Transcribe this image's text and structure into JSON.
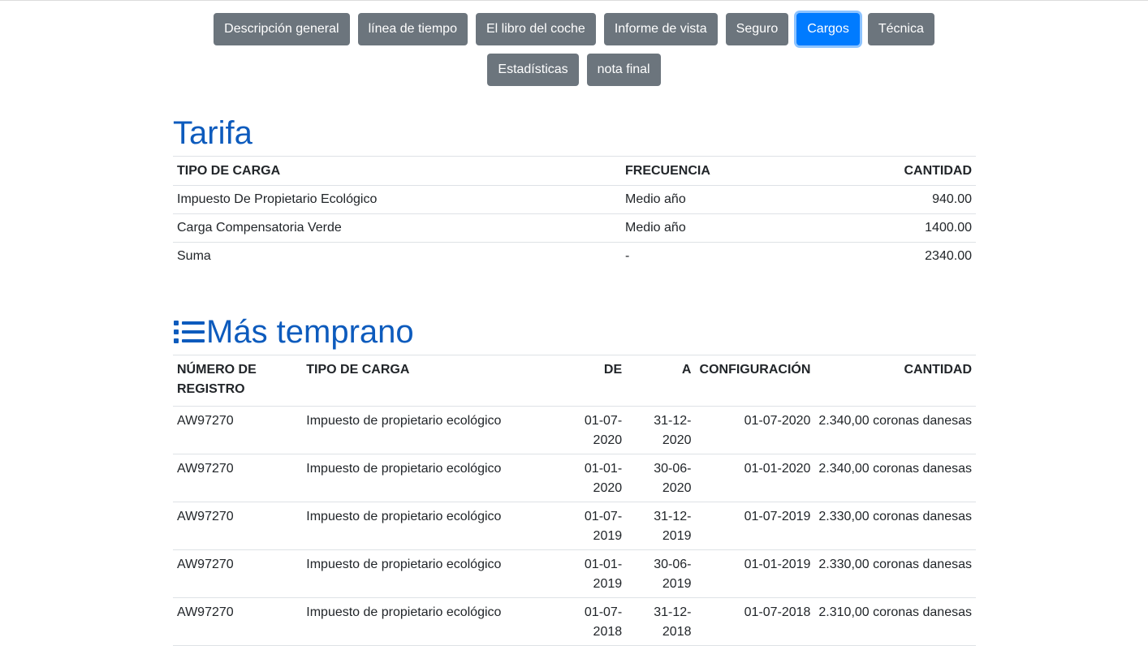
{
  "nav": {
    "row1": [
      {
        "label": "Descripción general",
        "active": false
      },
      {
        "label": "línea de tiempo",
        "active": false
      },
      {
        "label": "El libro del coche",
        "active": false
      },
      {
        "label": "Informe de vista",
        "active": false
      },
      {
        "label": "Seguro",
        "active": false
      },
      {
        "label": "Cargos",
        "active": true
      },
      {
        "label": "Técnica",
        "active": false
      }
    ],
    "row2": [
      {
        "label": "Estadísticas",
        "active": false
      },
      {
        "label": "nota final",
        "active": false
      }
    ]
  },
  "tarifa": {
    "title": "Tarifa",
    "headers": [
      "TIPO DE CARGA",
      "FRECUENCIA",
      "CANTIDAD"
    ],
    "rows": [
      [
        "Impuesto De Propietario Ecológico",
        "Medio año",
        "940.00"
      ],
      [
        "Carga Compensatoria Verde",
        "Medio año",
        "1400.00"
      ],
      [
        "Suma",
        "-",
        "2340.00"
      ]
    ]
  },
  "earlier": {
    "title": "Más temprano",
    "icon": "list-icon",
    "headers": {
      "registro": "NÚMERO DE REGISTRO",
      "tipo": "TIPO DE CARGA",
      "de": "DE",
      "a": "A",
      "config": "CONFIGURACIÓN",
      "cantidad": "CANTIDAD"
    },
    "rows": [
      {
        "registro": "AW97270",
        "tipo": "Impuesto de propietario ecológico",
        "de": [
          "01-07-",
          "2020"
        ],
        "a": [
          "31-12-",
          "2020"
        ],
        "config": "01-07-2020",
        "cantidad": "2.340,00 coronas danesas"
      },
      {
        "registro": "AW97270",
        "tipo": "Impuesto de propietario ecológico",
        "de": [
          "01-01-",
          "2020"
        ],
        "a": [
          "30-06-",
          "2020"
        ],
        "config": "01-01-2020",
        "cantidad": "2.340,00 coronas danesas"
      },
      {
        "registro": "AW97270",
        "tipo": "Impuesto de propietario ecológico",
        "de": [
          "01-07-",
          "2019"
        ],
        "a": [
          "31-12-",
          "2019"
        ],
        "config": "01-07-2019",
        "cantidad": "2.330,00 coronas danesas"
      },
      {
        "registro": "AW97270",
        "tipo": "Impuesto de propietario ecológico",
        "de": [
          "01-01-",
          "2019"
        ],
        "a": [
          "30-06-",
          "2019"
        ],
        "config": "01-01-2019",
        "cantidad": "2.330,00 coronas danesas"
      },
      {
        "registro": "AW97270",
        "tipo": "Impuesto de propietario ecológico",
        "de": [
          "01-07-",
          "2018"
        ],
        "a": [
          "31-12-",
          "2018"
        ],
        "config": "01-07-2018",
        "cantidad": "2.310,00 coronas danesas"
      }
    ]
  },
  "colors": {
    "button": "#6c757d",
    "active_button": "#007bff",
    "heading": "#0d5bbd"
  }
}
